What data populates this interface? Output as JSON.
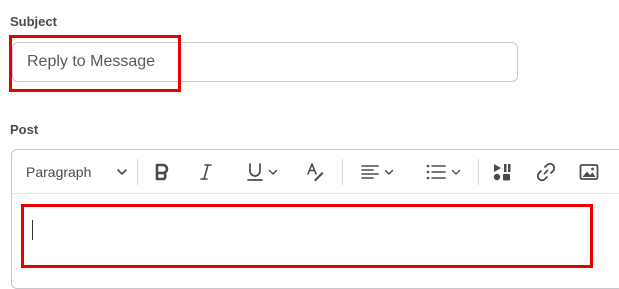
{
  "subject": {
    "label": "Subject",
    "value": "Reply to Message"
  },
  "post": {
    "label": "Post",
    "content": ""
  },
  "toolbar": {
    "paragraph_style": "Paragraph",
    "buttons": [
      {
        "name": "bold",
        "icon": "bold-icon"
      },
      {
        "name": "italic",
        "icon": "italic-icon"
      },
      {
        "name": "underline",
        "icon": "underline-icon",
        "has_dropdown": true
      },
      {
        "name": "clear-formatting",
        "icon": "text-style-icon"
      },
      {
        "name": "align",
        "icon": "align-left-icon",
        "has_dropdown": true
      },
      {
        "name": "bullet-list",
        "icon": "list-icon",
        "has_dropdown": true
      },
      {
        "name": "insert-media",
        "icon": "media-icon"
      },
      {
        "name": "insert-link",
        "icon": "link-icon"
      },
      {
        "name": "insert-image",
        "icon": "image-icon"
      }
    ]
  },
  "colors": {
    "highlight": "#e60000",
    "border": "#c6c9cc",
    "text": "#494c4e"
  }
}
